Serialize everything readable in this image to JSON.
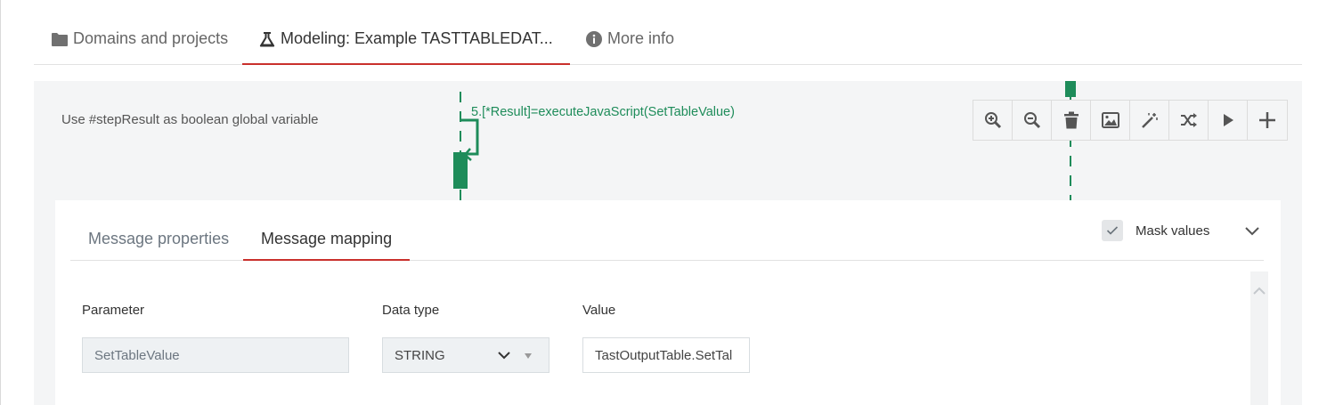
{
  "main_tabs": [
    {
      "label": "Domains and projects",
      "icon": "folder-icon"
    },
    {
      "label": "Modeling: Example TASTTABLEDAT...",
      "icon": "flask-icon",
      "active": true
    },
    {
      "label": "More info",
      "icon": "info-circle-icon"
    }
  ],
  "canvas": {
    "hint": "Use #stepResult as boolean global variable",
    "step_label": "5.[*Result]=executeJavaScript(SetTableValue)",
    "step_color": "#1e8c5a"
  },
  "toolbar": [
    {
      "name": "zoom-in-button",
      "icon": "zoom-in-icon"
    },
    {
      "name": "zoom-out-button",
      "icon": "zoom-out-icon"
    },
    {
      "name": "delete-button",
      "icon": "trash-icon"
    },
    {
      "name": "image-button",
      "icon": "image-icon"
    },
    {
      "name": "magic-button",
      "icon": "magic-wand-icon"
    },
    {
      "name": "shuffle-button",
      "icon": "shuffle-icon"
    },
    {
      "name": "run-button",
      "icon": "play-icon"
    },
    {
      "name": "add-button",
      "icon": "plus-icon"
    }
  ],
  "panel": {
    "tabs": [
      {
        "label": "Message properties"
      },
      {
        "label": "Message mapping",
        "active": true
      }
    ],
    "mask_values_label": "Mask values",
    "mask_values_checked": true,
    "columns": {
      "parameter": "Parameter",
      "data_type": "Data type",
      "value": "Value"
    },
    "row": {
      "parameter": "SetTableValue",
      "data_type": "STRING",
      "value": "TastOutputTable.SetTal"
    }
  },
  "colors": {
    "accent": "#c9302c",
    "diagram_green": "#1e8c5a",
    "canvas_bg": "#f4f5f6"
  }
}
